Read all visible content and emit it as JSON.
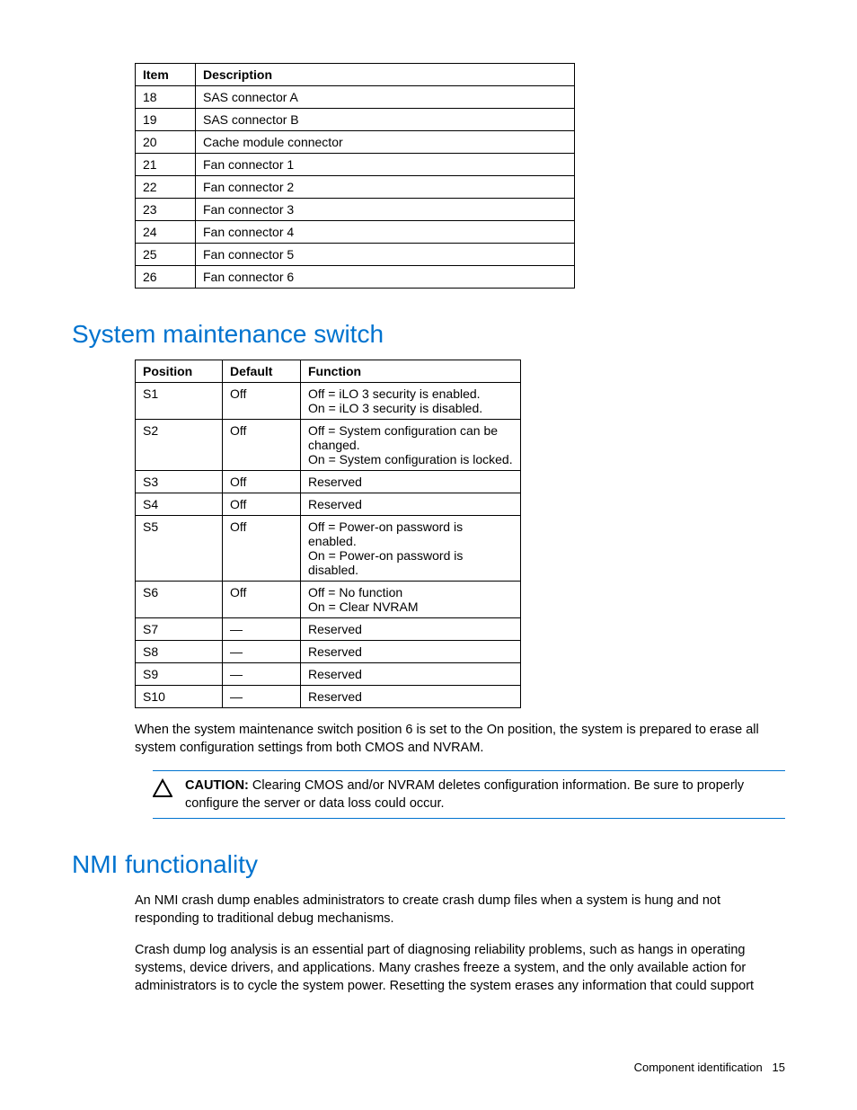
{
  "table1": {
    "headers": [
      "Item",
      "Description"
    ],
    "rows": [
      {
        "item": "18",
        "desc": "SAS connector A"
      },
      {
        "item": "19",
        "desc": "SAS connector B"
      },
      {
        "item": "20",
        "desc": "Cache module connector"
      },
      {
        "item": "21",
        "desc": "Fan connector 1"
      },
      {
        "item": "22",
        "desc": "Fan connector 2"
      },
      {
        "item": "23",
        "desc": "Fan connector 3"
      },
      {
        "item": "24",
        "desc": "Fan connector 4"
      },
      {
        "item": "25",
        "desc": "Fan connector 5"
      },
      {
        "item": "26",
        "desc": "Fan connector 6"
      }
    ]
  },
  "heading1": "System maintenance switch",
  "table2": {
    "headers": [
      "Position",
      "Default",
      "Function"
    ],
    "rows": [
      {
        "pos": "S1",
        "def": "Off",
        "fn": "Off = iLO 3 security is enabled.\nOn = iLO 3 security is disabled."
      },
      {
        "pos": "S2",
        "def": "Off",
        "fn": "Off = System configuration can be changed.\nOn = System configuration is locked."
      },
      {
        "pos": "S3",
        "def": "Off",
        "fn": "Reserved"
      },
      {
        "pos": "S4",
        "def": "Off",
        "fn": "Reserved"
      },
      {
        "pos": "S5",
        "def": "Off",
        "fn": "Off = Power-on password is enabled.\nOn = Power-on password is disabled."
      },
      {
        "pos": "S6",
        "def": "Off",
        "fn": "Off = No function\nOn = Clear NVRAM"
      },
      {
        "pos": "S7",
        "def": "—",
        "fn": "Reserved"
      },
      {
        "pos": "S8",
        "def": "—",
        "fn": "Reserved"
      },
      {
        "pos": "S9",
        "def": "—",
        "fn": "Reserved"
      },
      {
        "pos": "S10",
        "def": "—",
        "fn": "Reserved"
      }
    ]
  },
  "para1": "When the system maintenance switch position 6 is set to the On position, the system is prepared to erase all system configuration settings from both CMOS and NVRAM.",
  "caution": {
    "label": "CAUTION:",
    "text": "Clearing CMOS and/or NVRAM deletes configuration information. Be sure to properly configure the server or data loss could occur."
  },
  "heading2": "NMI functionality",
  "para2": "An NMI crash dump enables administrators to create crash dump files when a system is hung and not responding to traditional debug mechanisms.",
  "para3": "Crash dump log analysis is an essential part of diagnosing reliability problems, such as hangs in operating systems, device drivers, and applications. Many crashes freeze a system, and the only available action for administrators is to cycle the system power. Resetting the system erases any information that could support",
  "footer": {
    "text": "Component identification",
    "page": "15"
  }
}
